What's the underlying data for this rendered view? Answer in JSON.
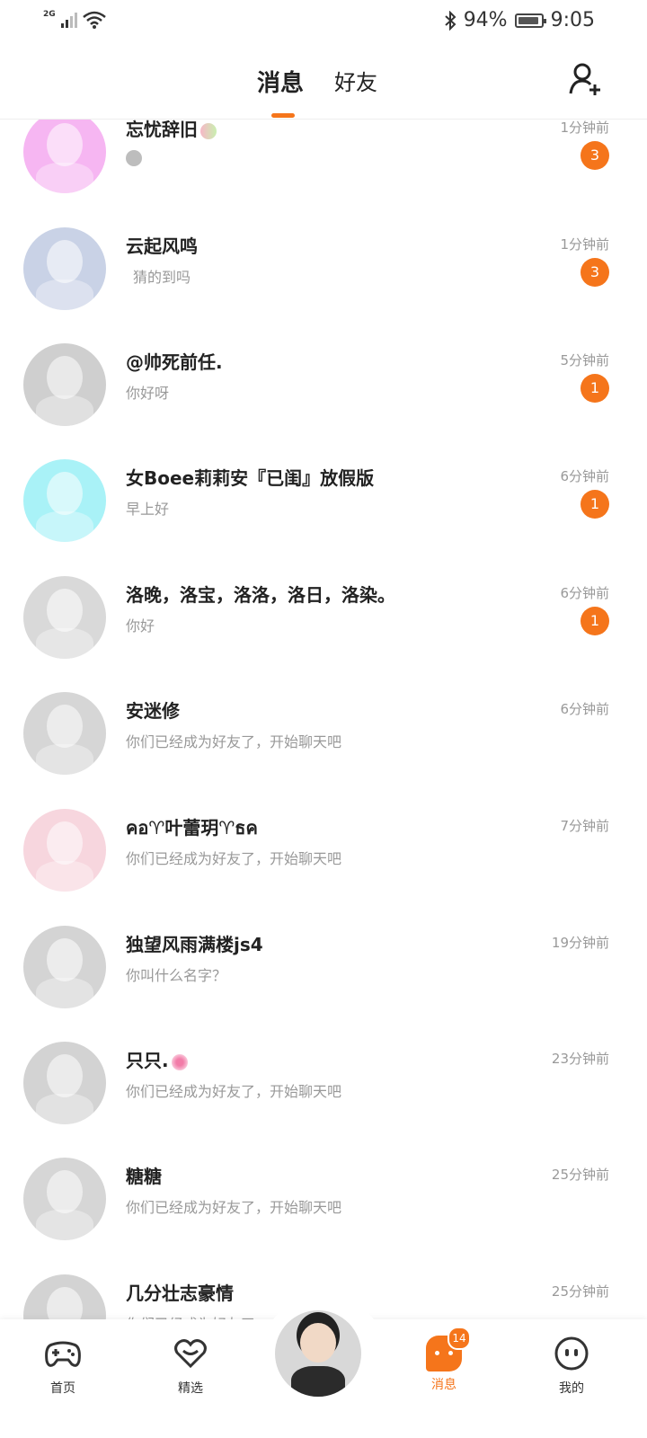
{
  "status_bar": {
    "network": "2G",
    "battery": "94%",
    "time": "9:05"
  },
  "header": {
    "tabs": [
      "消息",
      "好友"
    ]
  },
  "conversations": [
    {
      "name": "忘忧辞旧",
      "preview": "",
      "time": "1分钟前",
      "unread": "3",
      "avatar_color": "#f6b6f2"
    },
    {
      "name": "云起风鸣",
      "preview": "猜的到吗",
      "time": "1分钟前",
      "unread": "3",
      "avatar_color": "#c9d2e6"
    },
    {
      "name": "@帅死前任.",
      "preview": "你好呀",
      "time": "5分钟前",
      "unread": "1",
      "avatar_color": "#cfcfcf"
    },
    {
      "name": "女Boee莉莉安『已闺』放假版",
      "preview": "早上好",
      "time": "6分钟前",
      "unread": "1",
      "avatar_color": "#a9f2f7"
    },
    {
      "name": "洛晚，洛宝，洛洛，洛日，洛染。",
      "preview": "你好",
      "time": "6分钟前",
      "unread": "1",
      "avatar_color": "#d9d9d9"
    },
    {
      "name": "安迷修",
      "preview": "你们已经成为好友了，开始聊天吧",
      "time": "6分钟前",
      "unread": "",
      "avatar_color": "#d6d6d6"
    },
    {
      "name": "คอ♈叶蕾玥♈ธค",
      "preview": "你们已经成为好友了，开始聊天吧",
      "time": "7分钟前",
      "unread": "",
      "avatar_color": "#f7d6de"
    },
    {
      "name": "独望风雨满楼js4",
      "preview": "你叫什么名字？",
      "time": "19分钟前",
      "unread": "",
      "avatar_color": "#d4d4d4"
    },
    {
      "name": "只只.",
      "preview": "你们已经成为好友了，开始聊天吧",
      "time": "23分钟前",
      "unread": "",
      "avatar_color": "#d3d3d3"
    },
    {
      "name": "糖糖",
      "preview": "你们已经成为好友了，开始聊天吧",
      "time": "25分钟前",
      "unread": "",
      "avatar_color": "#d6d6d6"
    },
    {
      "name": "几分壮志豪情",
      "preview": "你们已经成为好友了",
      "time": "25分钟前",
      "unread": "",
      "avatar_color": "#d3d3d3"
    }
  ],
  "bottom_nav": {
    "home": "首页",
    "featured": "精选",
    "messages": "消息",
    "messages_badge": "14",
    "mine": "我的"
  },
  "colors": {
    "accent": "#f5751b",
    "muted_text": "#999999"
  }
}
